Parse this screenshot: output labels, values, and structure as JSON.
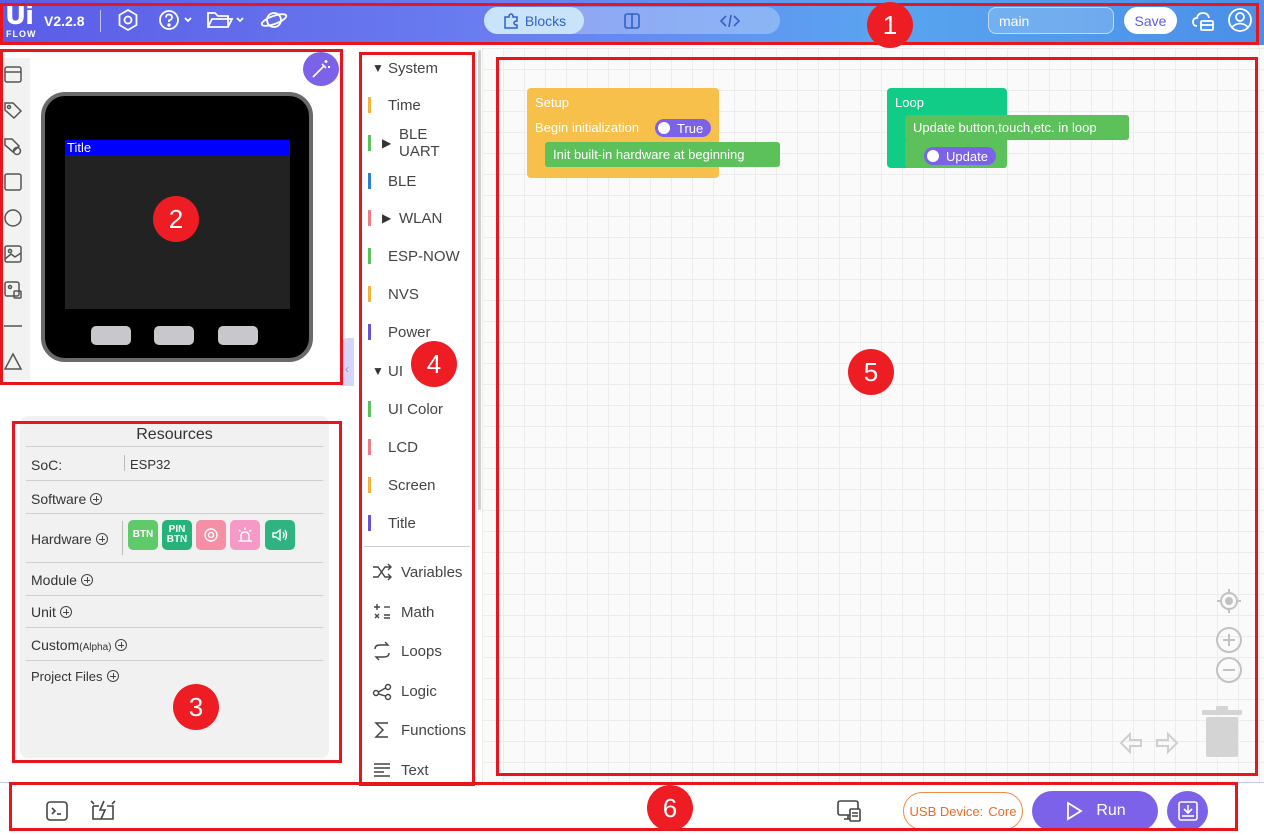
{
  "header": {
    "logo_top": "Ui",
    "logo_bottom": "FLOW",
    "version": "V2.2.8",
    "modes": [
      {
        "label": "Blocks",
        "active": true
      },
      {
        "label": "",
        "icon": "split-view-icon"
      },
      {
        "label": "",
        "icon": "code-icon"
      }
    ],
    "file_name": "main",
    "save_label": "Save",
    "icons": [
      "settings-icon",
      "help-icon",
      "folder-icon",
      "planet-icon",
      "cloud-icon",
      "user-icon"
    ]
  },
  "device": {
    "screen_title": "Title"
  },
  "resources": {
    "title": "Resources",
    "soc_label": "SoC:",
    "soc_value": "ESP32",
    "software_label": "Software",
    "hardware_label": "Hardware",
    "hardware_badges": [
      {
        "label": "BTN",
        "color": "#5fca6a"
      },
      {
        "label": "PIN BTN",
        "color": "#26b37a"
      },
      {
        "label": "",
        "color": "#f48fa6",
        "icon": "rgb-icon"
      },
      {
        "label": "",
        "color": "#f799c6",
        "icon": "light-icon"
      },
      {
        "label": "",
        "color": "#2fb381",
        "icon": "speaker-icon"
      }
    ],
    "module_label": "Module",
    "unit_label": "Unit",
    "custom_label": "Custom",
    "custom_suffix": "(Alpha)",
    "project_files_label": "Project Files"
  },
  "categories": [
    {
      "label": "System",
      "type": "group",
      "expanded": true
    },
    {
      "label": "Time",
      "color": "#f5b23e"
    },
    {
      "label": "BLE UART",
      "color": "#5cc15a",
      "collapsed": true
    },
    {
      "label": "BLE",
      "color": "#2d7fd6"
    },
    {
      "label": "WLAN",
      "color": "#f07b8a",
      "collapsed": true
    },
    {
      "label": "ESP-NOW",
      "color": "#5cc15a"
    },
    {
      "label": "NVS",
      "color": "#f5b23e"
    },
    {
      "label": "Power",
      "color": "#6b51d8"
    },
    {
      "label": "UI",
      "type": "group",
      "expanded": true
    },
    {
      "label": "UI Color",
      "color": "#5cc15a"
    },
    {
      "label": "LCD",
      "color": "#f07b8a"
    },
    {
      "label": "Screen",
      "color": "#f5b23e"
    },
    {
      "label": "Title",
      "color": "#6b51d8"
    }
  ],
  "categories_builtin": [
    {
      "label": "Variables",
      "icon": "variables-icon"
    },
    {
      "label": "Math",
      "icon": "math-icon"
    },
    {
      "label": "Loops",
      "icon": "loops-icon"
    },
    {
      "label": "Logic",
      "icon": "logic-icon"
    },
    {
      "label": "Functions",
      "icon": "sigma-icon"
    },
    {
      "label": "Text",
      "icon": "text-icon"
    }
  ],
  "blocks": {
    "setup": {
      "title": "Setup",
      "begin_label": "Begin initialization",
      "begin_value": "True",
      "init_label": "Init built-in hardware at beginning"
    },
    "loop": {
      "title": "Loop",
      "update_label": "Update button,touch,etc. in loop",
      "update_value": "Update"
    }
  },
  "footer": {
    "usb_label": "USB Device:",
    "usb_device": "Core",
    "run_label": "Run"
  },
  "annotations": [
    "1",
    "2",
    "3",
    "4",
    "5",
    "6"
  ]
}
